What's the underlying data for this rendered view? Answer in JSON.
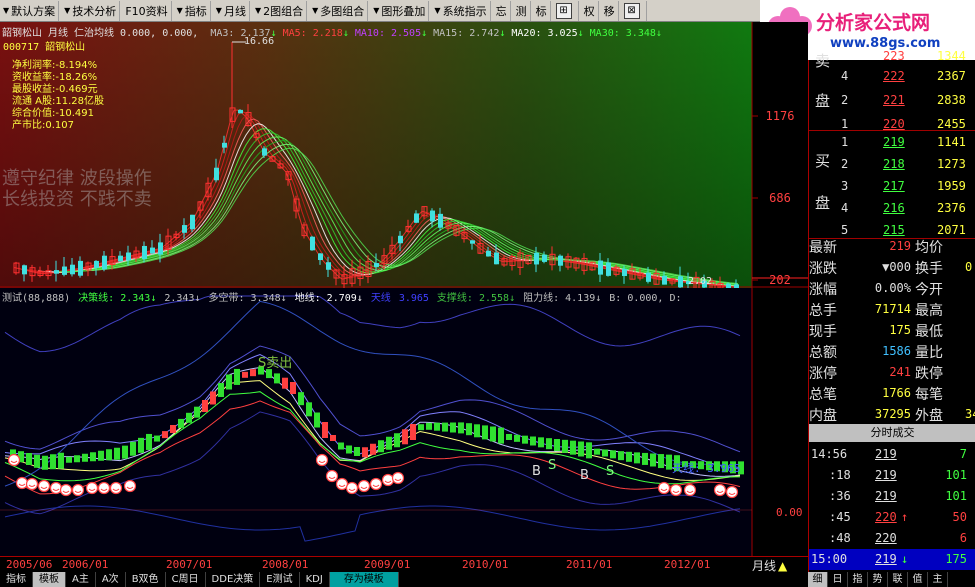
{
  "toolbar": {
    "items": [
      {
        "label": "默认方案",
        "arrow": true
      },
      {
        "label": "技术分析",
        "arrow": true
      },
      {
        "label": "F10资料",
        "arrow": false
      },
      {
        "label": "指标",
        "arrow": true
      },
      {
        "label": "月线",
        "arrow": true
      },
      {
        "label": "2图组合",
        "arrow": true
      },
      {
        "label": "多图组合",
        "arrow": true
      },
      {
        "label": "图形叠加",
        "arrow": true
      },
      {
        "label": "系统指示",
        "arrow": true
      },
      {
        "label": "忘",
        "arrow": false
      },
      {
        "label": "测",
        "arrow": false
      },
      {
        "label": "标",
        "arrow": false
      }
    ],
    "icons": [
      {
        "name": "grid-icon",
        "glyph": "⊞"
      },
      {
        "label": "权"
      },
      {
        "label": "移"
      },
      {
        "name": "close-icon",
        "glyph": "⊠"
      }
    ]
  },
  "logo": {
    "brand": "分析家公式网",
    "url": "www.88gs.com"
  },
  "main_chart": {
    "header": "韶钢松山 月线 仁治均线 0.000, 0.000,",
    "ma_line": [
      {
        "label": "MA3:",
        "value": "2.137",
        "dir": "down",
        "color": "#c0c0c0"
      },
      {
        "label": "MA5:",
        "value": "2.218",
        "dir": "down",
        "color": "#ff4040"
      },
      {
        "label": "MA10:",
        "value": "2.505",
        "dir": "down",
        "color": "#c040ff"
      },
      {
        "label": "MA15:",
        "value": "2.742",
        "dir": "down",
        "color": "#c0c0c0"
      },
      {
        "label": "MA20:",
        "value": "3.025",
        "dir": "down",
        "color": "#ffffff"
      },
      {
        "label": "MA30:",
        "value": "3.348",
        "dir": "down",
        "color": "#40ff40"
      }
    ],
    "code": "000717 韶钢松山",
    "high_mark": "16.66",
    "low_mark": "2.02",
    "finance": [
      "净利润率:-8.194%",
      "资收益率:-18.26%",
      "最股收益:-0.469元",
      "流通 A股:11.28亿股",
      "综合价值:-10.491",
      "产市比:0.107"
    ],
    "watermark": [
      "遵守纪律 波段操作",
      "长线投资 不践不卖"
    ],
    "y_labels": [
      "1176",
      "686",
      "202"
    ]
  },
  "indicator": {
    "header": [
      {
        "text": "测试(88,888)",
        "color": "#c0c0c0"
      },
      {
        "text": "决策线: 2.343↓",
        "color": "#40ff40"
      },
      {
        "text": "2.343↓",
        "color": "#c0c0c0"
      },
      {
        "text": "多空带: 3.348↓",
        "color": "#c0c0c0"
      },
      {
        "text": "地线: 2.709↓",
        "color": "#ffffff"
      },
      {
        "text": "天线",
        "color": "#4040ff"
      },
      {
        "text": "3.965",
        "color": "#4040ff"
      },
      {
        "text": "支撑线: 2.558↓",
        "color": "#40c040"
      },
      {
        "text": "阻力线: 4.139↓",
        "color": "#c0c0c0"
      },
      {
        "text": "B: 0.000, D:",
        "color": "#c0c0c0"
      }
    ],
    "labels": {
      "sell": "S卖出",
      "buy_mark": "B",
      "sell_mark": "S",
      "sky": "天线: 3.965",
      "ground": "地线",
      "zero": "0.00"
    }
  },
  "time_axis": {
    "labels": [
      "2005/06",
      "2006/01",
      "2007/01",
      "2008/01",
      "2009/01",
      "2010/01",
      "2011/01",
      "2012/01"
    ],
    "period": "月线"
  },
  "bottom_tabs": [
    "指标",
    "模板",
    "A主",
    "A次",
    "B双色",
    "C周日",
    "DDE决策",
    "E测试",
    "KDJ",
    "存为模板"
  ],
  "order_book": {
    "sell": [
      {
        "level": "4",
        "price": "222",
        "vol": "2367"
      },
      {
        "level": "2",
        "price": "221",
        "vol": "2838"
      },
      {
        "level": "1",
        "price": "220",
        "vol": "2455"
      }
    ],
    "sell_top_partial": {
      "price": "223",
      "vol": "1344"
    },
    "buy": [
      {
        "level": "1",
        "price": "219",
        "vol": "1141"
      },
      {
        "level": "2",
        "price": "218",
        "vol": "1273"
      },
      {
        "level": "3",
        "price": "217",
        "vol": "1959"
      },
      {
        "level": "4",
        "price": "216",
        "vol": "2376"
      },
      {
        "level": "5",
        "price": "215",
        "vol": "2071"
      }
    ],
    "sell_side_label": [
      "卖",
      "盘"
    ],
    "buy_side_label": [
      "买",
      "盘"
    ]
  },
  "quote": {
    "rows": [
      {
        "l1": "最新",
        "v1": "219",
        "l2": "均价",
        "v2": ""
      },
      {
        "l1": "涨跌",
        "v1": "▼000",
        "l2": "换手",
        "v2": "0"
      },
      {
        "l1": "涨幅",
        "v1": "0.00%",
        "l2": "今开",
        "v2": ""
      },
      {
        "l1": "总手",
        "v1": "71714",
        "l2": "最高",
        "v2": ""
      },
      {
        "l1": "现手",
        "v1": "175",
        "l2": "最低",
        "v2": ""
      },
      {
        "l1": "总额",
        "v1": "1586",
        "l2": "量比",
        "v2": ""
      },
      {
        "l1": "涨停",
        "v1": "241",
        "l2": "跌停",
        "v2": ""
      },
      {
        "l1": "总笔",
        "v1": "1766",
        "l2": "每笔",
        "v2": ""
      },
      {
        "l1": "内盘",
        "v1": "37295",
        "l2": "外盘",
        "v2": "34"
      }
    ]
  },
  "ticks": {
    "title": "分时成交",
    "rows": [
      {
        "time": "14:56",
        "price": "219",
        "vol": "7",
        "mark": ""
      },
      {
        "time": ":18",
        "price": "219",
        "vol": "101",
        "mark": ""
      },
      {
        "time": ":36",
        "price": "219",
        "vol": "101",
        "mark": ""
      },
      {
        "time": ":45",
        "price": "220",
        "vol": "50",
        "mark": "↑"
      },
      {
        "time": ":48",
        "price": "220",
        "vol": "6",
        "mark": ""
      },
      {
        "time": "15:00",
        "price": "219",
        "vol": "175",
        "mark": "↓"
      }
    ]
  },
  "right_tabs": [
    "细",
    "日",
    "指",
    "势",
    "联",
    "值",
    "主"
  ]
}
